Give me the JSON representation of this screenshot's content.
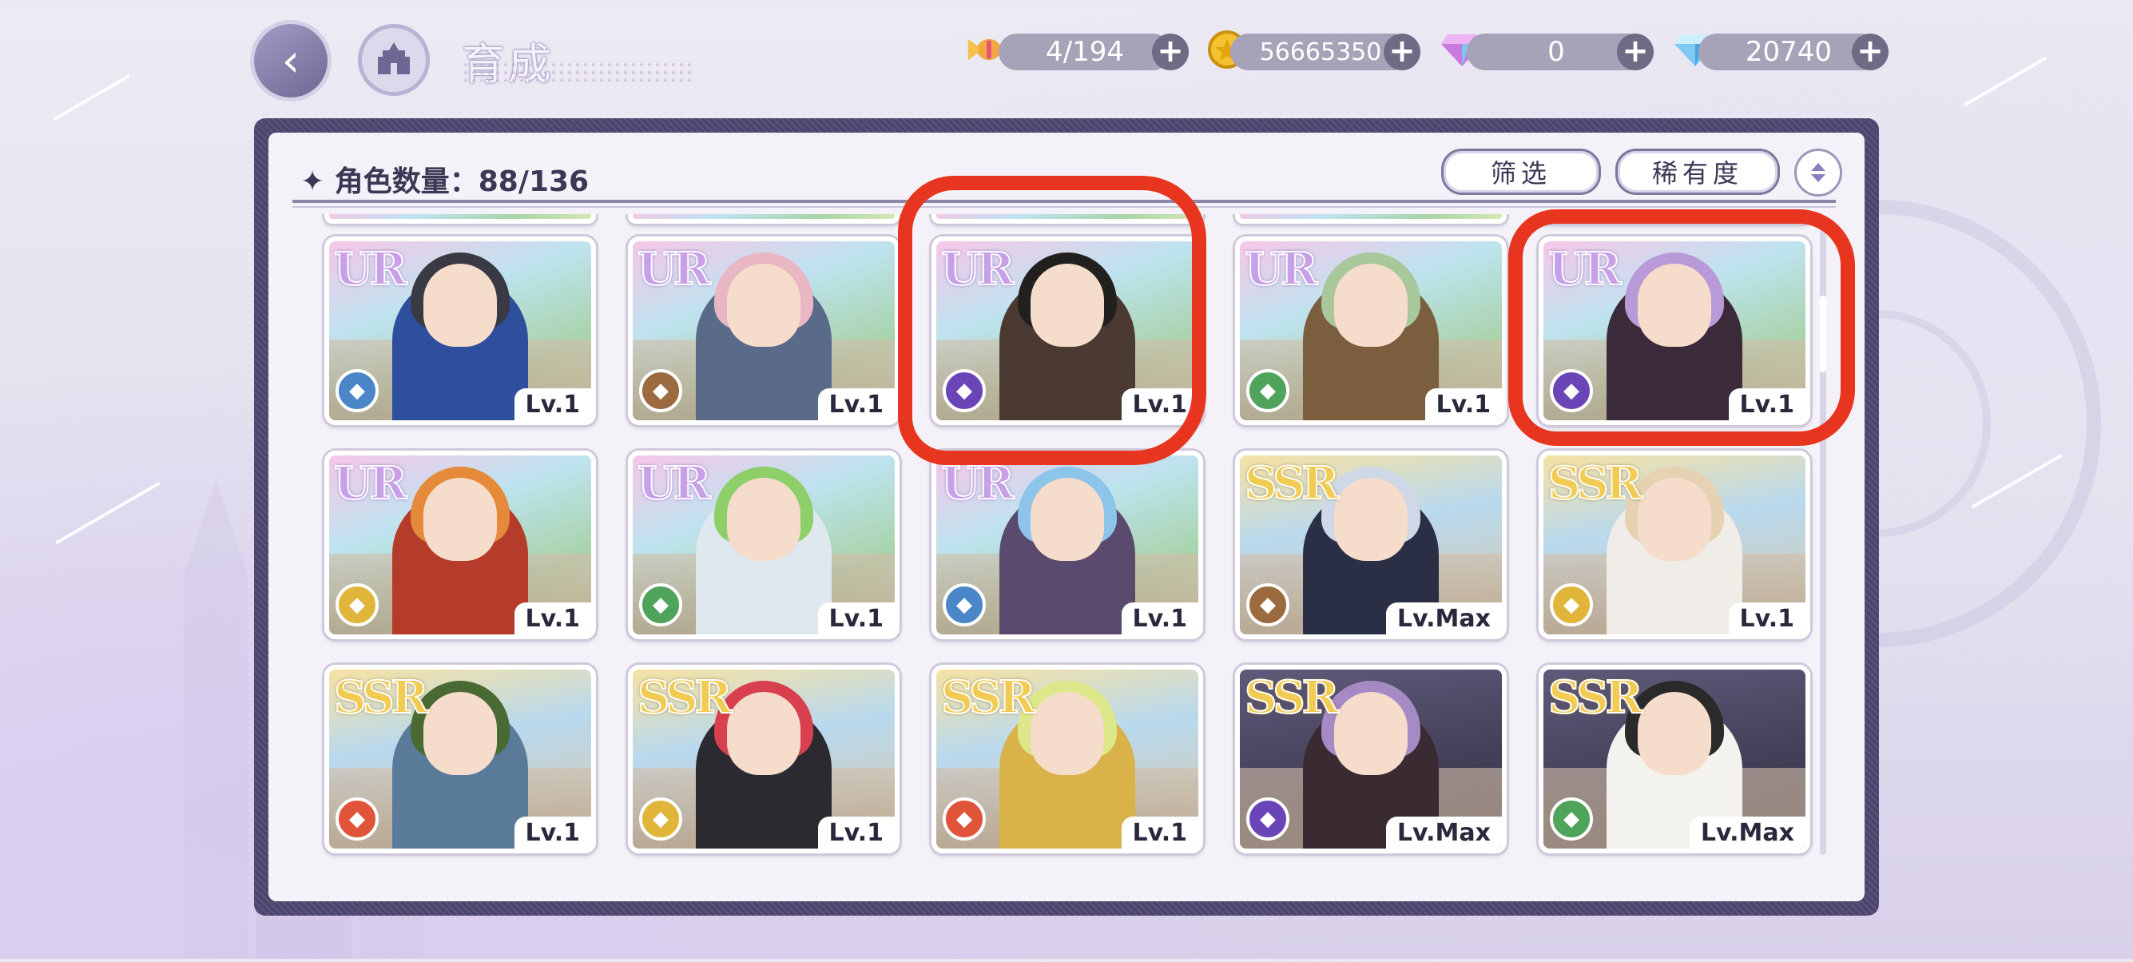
{
  "header": {
    "title": "育成",
    "resources": [
      {
        "name": "candy",
        "icon": "candy-icon",
        "value": "4/194"
      },
      {
        "name": "gold",
        "icon": "coin-icon",
        "value": "56665350"
      },
      {
        "name": "gem",
        "icon": "prism-gem-icon",
        "value": "0"
      },
      {
        "name": "diamond",
        "icon": "diamond-icon",
        "value": "20740"
      }
    ]
  },
  "panel": {
    "count_label": "✦ 角色数量：88/136",
    "filter_button": "筛选",
    "rarity_button": "稀有度"
  },
  "cards": [
    {
      "rarity": "UR",
      "level": "Lv.1",
      "role_color": "#4a86c8",
      "role_icon": "shield-icon",
      "hair": "#3a3a45",
      "outfit": "#2d4f9e",
      "circled": false
    },
    {
      "rarity": "UR",
      "level": "Lv.1",
      "role_color": "#9b6a3e",
      "role_icon": "gauntlet-icon",
      "hair": "#e9b7c4",
      "outfit": "#5a6b8a",
      "circled": false
    },
    {
      "rarity": "UR",
      "level": "Lv.1",
      "role_color": "#6b45b8",
      "role_icon": "boot-icon",
      "hair": "#22201f",
      "outfit": "#4a3a32",
      "circled": true
    },
    {
      "rarity": "UR",
      "level": "Lv.1",
      "role_color": "#4fa35a",
      "role_icon": "boot-icon",
      "hair": "#a8c79a",
      "outfit": "#7a5e3e",
      "circled": false
    },
    {
      "rarity": "UR",
      "level": "Lv.1",
      "role_color": "#6b45b8",
      "role_icon": "book-icon",
      "hair": "#b89ad8",
      "outfit": "#3a2a3a",
      "circled": true
    },
    {
      "rarity": "UR",
      "level": "Lv.1",
      "role_color": "#e1b53a",
      "role_icon": "shield-icon",
      "hair": "#e48a3a",
      "outfit": "#b53b2a",
      "circled": false
    },
    {
      "rarity": "UR",
      "level": "Lv.1",
      "role_color": "#4fa35a",
      "role_icon": "book-icon",
      "hair": "#8fcf6a",
      "outfit": "#dfe8ee",
      "circled": false
    },
    {
      "rarity": "UR",
      "level": "Lv.1",
      "role_color": "#4a86c8",
      "role_icon": "wand-icon",
      "hair": "#8cc4ea",
      "outfit": "#5a4a6e",
      "circled": false
    },
    {
      "rarity": "SSR",
      "level": "Lv.Max",
      "role_color": "#9b6a3e",
      "role_icon": "fist-icon",
      "hair": "#cfd8e6",
      "outfit": "#2a2f45",
      "circled": false
    },
    {
      "rarity": "SSR",
      "level": "Lv.1",
      "role_color": "#e1b53a",
      "role_icon": "wand-icon",
      "hair": "#e6d2b2",
      "outfit": "#f0ece8",
      "circled": false
    },
    {
      "rarity": "SSR",
      "level": "Lv.1",
      "role_color": "#e0553a",
      "role_icon": "wand-icon",
      "hair": "#4a6a34",
      "outfit": "#5a7a9a",
      "circled": false
    },
    {
      "rarity": "SSR",
      "level": "Lv.1",
      "role_color": "#e1b53a",
      "role_icon": "fist-icon",
      "hair": "#d9404f",
      "outfit": "#2a2a30",
      "circled": false
    },
    {
      "rarity": "SSR",
      "level": "Lv.1",
      "role_color": "#e0553a",
      "role_icon": "shield-icon",
      "hair": "#dde88a",
      "outfit": "#d9b24a",
      "circled": false
    },
    {
      "rarity": "SSR",
      "level": "Lv.Max",
      "role_color": "#6b45b8",
      "role_icon": "book-icon",
      "hair": "#a68ac4",
      "outfit": "#3a2a32",
      "circled": false
    },
    {
      "rarity": "SSR",
      "level": "Lv.Max",
      "role_color": "#4fa35a",
      "role_icon": "wand-icon",
      "hair": "#2a2a2a",
      "outfit": "#f4f2ee",
      "circled": false
    }
  ]
}
